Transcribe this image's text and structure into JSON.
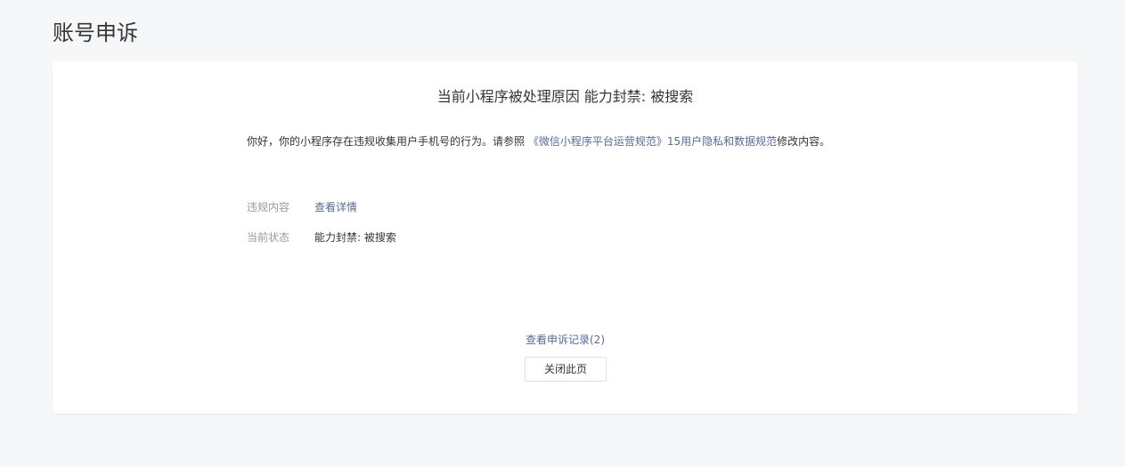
{
  "page": {
    "title": "账号申诉"
  },
  "card": {
    "heading": "当前小程序被处理原因 能力封禁: 被搜索",
    "notice": {
      "prefix": "你好，你的小程序存在违规收集用户手机号的行为。请参照 ",
      "link_text": "《微信小程序平台运营规范》15用户隐私和数据规范",
      "suffix": "修改内容。"
    },
    "info": [
      {
        "label": "违规内容",
        "value": "查看详情",
        "is_link": true
      },
      {
        "label": "当前状态",
        "value": "能力封禁: 被搜索",
        "is_link": false
      }
    ],
    "record_link": "查看申诉记录(2)",
    "close_button": "关闭此页"
  },
  "colors": {
    "background": "#f6f7f9",
    "card": "#ffffff",
    "link": "#576b95",
    "label": "#9a9a9a",
    "text": "#353535"
  }
}
